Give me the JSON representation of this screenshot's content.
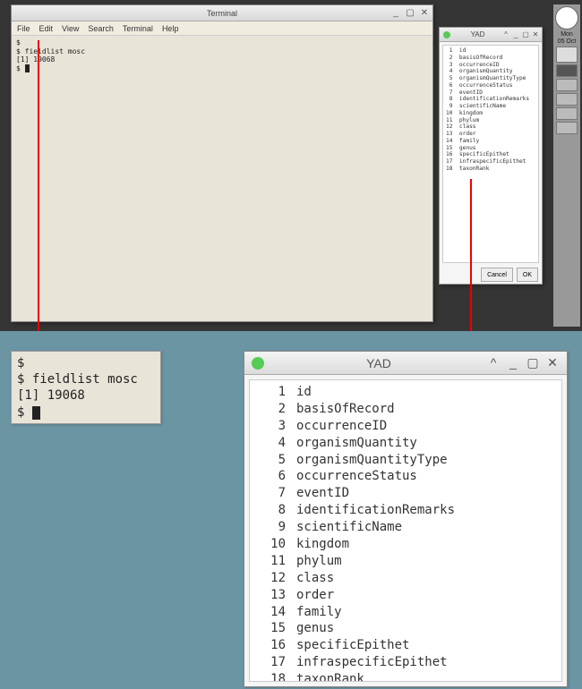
{
  "terminal": {
    "title": "Terminal",
    "menu": [
      "File",
      "Edit",
      "View",
      "Search",
      "Terminal",
      "Help"
    ],
    "lines": [
      "$",
      "$ fieldlist mosc",
      "[1] 19068",
      "$ "
    ],
    "controls": {
      "min": "_",
      "max": "▢",
      "close": "✕"
    }
  },
  "yad": {
    "title": "YAD",
    "controls": {
      "up": "^",
      "min": "_",
      "max": "▢",
      "close": "✕"
    },
    "items": [
      {
        "n": 1,
        "label": "id"
      },
      {
        "n": 2,
        "label": "basisOfRecord"
      },
      {
        "n": 3,
        "label": "occurrenceID"
      },
      {
        "n": 4,
        "label": "organismQuantity"
      },
      {
        "n": 5,
        "label": "organismQuantityType"
      },
      {
        "n": 6,
        "label": "occurrenceStatus"
      },
      {
        "n": 7,
        "label": "eventID"
      },
      {
        "n": 8,
        "label": "identificationRemarks"
      },
      {
        "n": 9,
        "label": "scientificName"
      },
      {
        "n": 10,
        "label": "kingdom"
      },
      {
        "n": 11,
        "label": "phylum"
      },
      {
        "n": 12,
        "label": "class"
      },
      {
        "n": 13,
        "label": "order"
      },
      {
        "n": 14,
        "label": "family"
      },
      {
        "n": 15,
        "label": "genus"
      },
      {
        "n": 16,
        "label": "specificEpithet"
      },
      {
        "n": 17,
        "label": "infraspecificEpithet"
      },
      {
        "n": 18,
        "label": "taxonRank"
      }
    ],
    "buttons": {
      "cancel": "Cancel",
      "ok": "OK"
    }
  },
  "panel": {
    "day": "Mon",
    "date": "05 Oct"
  },
  "term_zoom": {
    "lines": [
      "$",
      "$ fieldlist mosc",
      "[1] 19068",
      "$ "
    ]
  }
}
